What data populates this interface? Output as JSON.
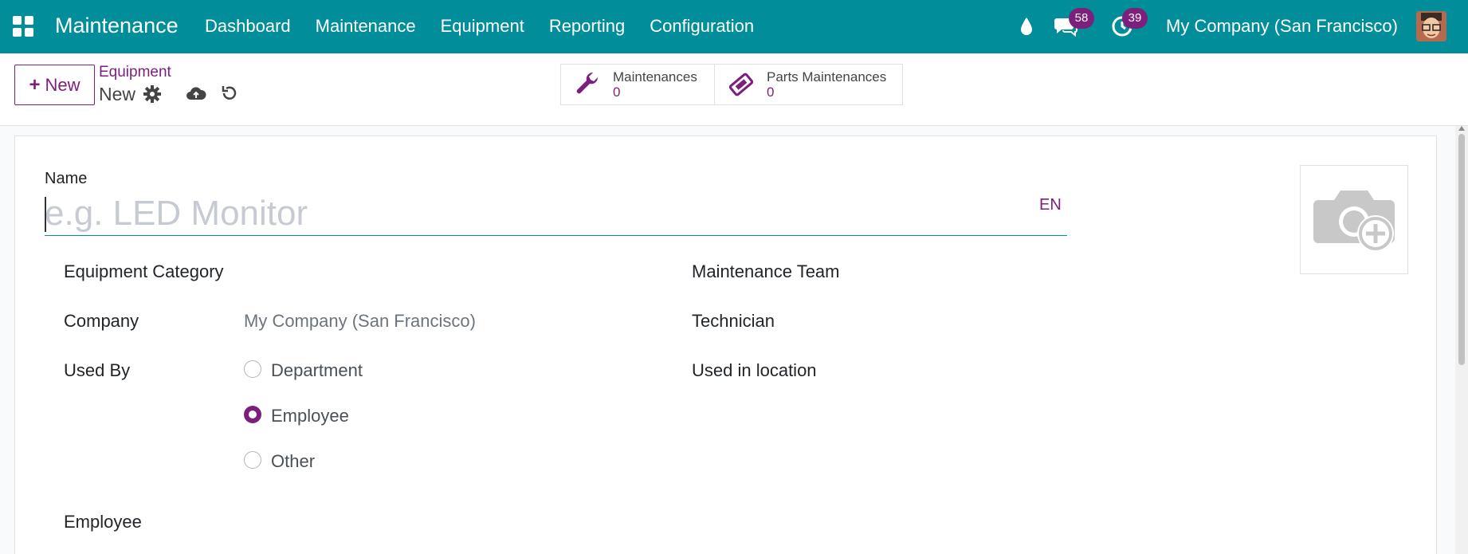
{
  "navbar": {
    "brand": "Maintenance",
    "menu": [
      "Dashboard",
      "Maintenance",
      "Equipment",
      "Reporting",
      "Configuration"
    ],
    "chat_count": "58",
    "activity_count": "39",
    "company": "My Company (San Francisco)"
  },
  "control": {
    "new_label": "New",
    "breadcrumb": "Equipment",
    "record_name": "New",
    "smart_buttons": [
      {
        "label": "Maintenances",
        "value": "0"
      },
      {
        "label": "Parts Maintenances",
        "value": "0"
      }
    ]
  },
  "form": {
    "name_label": "Name",
    "name_placeholder": "e.g. LED Monitor",
    "lang": "EN",
    "left": {
      "category_label": "Equipment Category",
      "company_label": "Company",
      "company_value": "My Company (San Francisco)",
      "used_by_label": "Used By",
      "used_by_options": [
        "Department",
        "Employee",
        "Other"
      ],
      "used_by_selected": "Employee",
      "employee_label": "Employee"
    },
    "right": {
      "team_label": "Maintenance Team",
      "technician_label": "Technician",
      "location_label": "Used in location"
    }
  },
  "colors": {
    "navbar": "#018e9a",
    "primary": "#7c1f7d"
  }
}
